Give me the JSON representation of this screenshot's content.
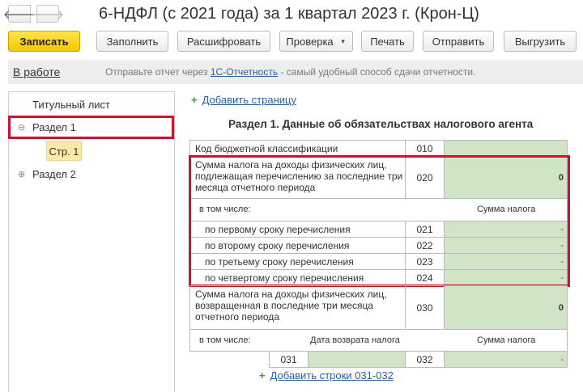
{
  "window": {
    "title": "6-НДФЛ (с 2021 года) за 1 квартал 2023 г. (Крон-Ц)"
  },
  "toolbar": {
    "save": "Записать",
    "fill": "Заполнить",
    "decode": "Расшифровать",
    "check": "Проверка",
    "print": "Печать",
    "send": "Отправить",
    "export": "Выгрузить"
  },
  "status": {
    "state": "В работе",
    "prefix": "Отправьте отчет через",
    "link": "1С-Отчетность",
    "suffix": "- самый удобный способ сдачи отчетности."
  },
  "tree": {
    "items": [
      {
        "label": "Титульный лист"
      },
      {
        "label": "Раздел 1",
        "expander": "⊖"
      },
      {
        "label": "Стр. 1"
      },
      {
        "label": "Раздел 2",
        "expander": "⊕"
      }
    ]
  },
  "form": {
    "add_page": "Добавить страницу",
    "section_title": "Раздел 1. Данные об обязательствах налогового агента",
    "kbk": {
      "label": "Код бюджетной классификации",
      "code": "010",
      "value": ""
    },
    "tax020": {
      "label": "Сумма налога на доходы физических лиц, подлежащая перечислению за последние три месяца отчетного периода",
      "code": "020",
      "value": "0"
    },
    "including": "в том числе:",
    "tax_sum_header": "Сумма налога",
    "terms": [
      {
        "label": "по первому сроку перечисления",
        "code": "021",
        "value": "-"
      },
      {
        "label": "по второму сроку перечисления",
        "code": "022",
        "value": "-"
      },
      {
        "label": "по третьему сроку перечисления",
        "code": "023",
        "value": "-"
      },
      {
        "label": "по четвертому сроку перечисления",
        "code": "024",
        "value": "-"
      }
    ],
    "tax030": {
      "label": "Сумма налога на доходы физических лиц, возвращенная в последние три месяца отчетного периода",
      "code": "030",
      "value": "0"
    },
    "including2": "в том числе:",
    "return_date_header": "Дата возврата налога",
    "tax_sum_header2": "Сумма налога",
    "row031": {
      "code": "031",
      "date": "",
      "code2": "032",
      "value": "-"
    },
    "add_rows": "Добавить строки 031-032"
  },
  "colors": {
    "highlight_red": "#d0112b",
    "field_green": "#cfe5c5",
    "accent_yellow": "#f6c800"
  }
}
